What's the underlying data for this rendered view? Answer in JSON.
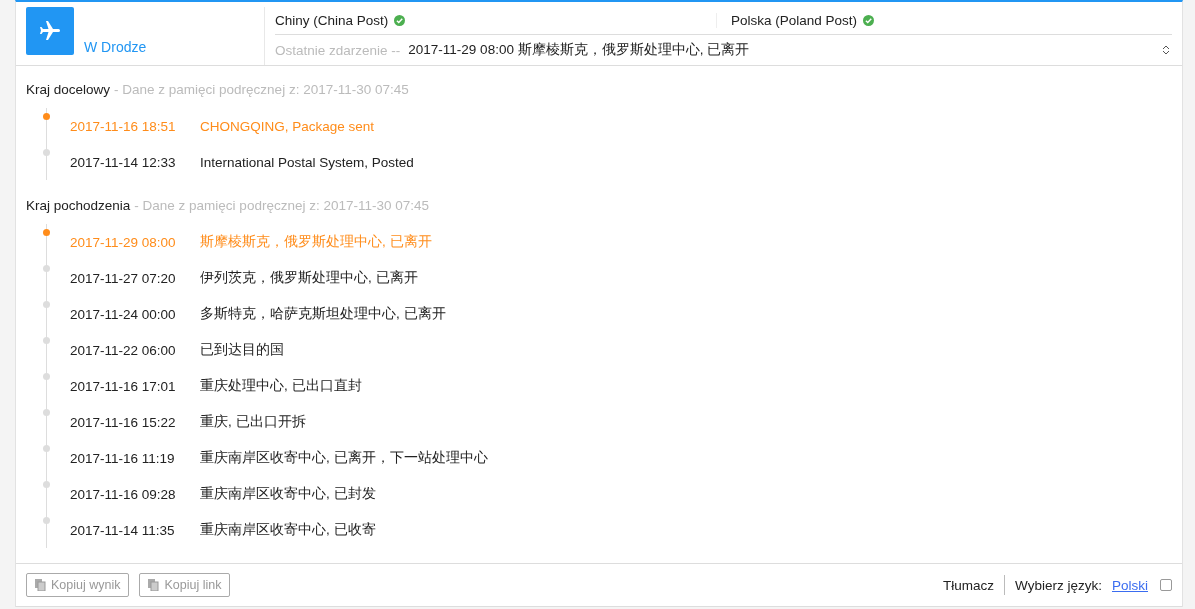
{
  "header": {
    "status": "W Drodze",
    "carriers": [
      {
        "name": "Chiny (China Post)",
        "verified": true
      },
      {
        "name": "Polska (Poland Post)",
        "verified": true
      }
    ],
    "last_event_label": "Ostatnie zdarzenie --",
    "last_event": "2017-11-29 08:00 斯摩棱斯克，俄罗斯处理中心, 已离开",
    "expanded": false
  },
  "sections": [
    {
      "title": "Kraj docelowy",
      "cache_note": "- Dane z pamięci podręcznej z: 2017-11-30 07:45",
      "events": [
        {
          "time": "2017-11-16 18:51",
          "text": "CHONGQING, Package sent",
          "latest": true
        },
        {
          "time": "2017-11-14 12:33",
          "text": "International Postal System, Posted",
          "latest": false
        }
      ]
    },
    {
      "title": "Kraj pochodzenia",
      "cache_note": "- Dane z pamięci podręcznej z: 2017-11-30 07:45",
      "events": [
        {
          "time": "2017-11-29 08:00",
          "text": "斯摩棱斯克，俄罗斯处理中心, 已离开",
          "latest": true
        },
        {
          "time": "2017-11-27 07:20",
          "text": "伊列茨克，俄罗斯处理中心, 已离开",
          "latest": false
        },
        {
          "time": "2017-11-24 00:00",
          "text": "多斯特克，哈萨克斯坦处理中心, 已离开",
          "latest": false
        },
        {
          "time": "2017-11-22 06:00",
          "text": "已到达目的国",
          "latest": false
        },
        {
          "time": "2017-11-16 17:01",
          "text": "重庆处理中心, 已出口直封",
          "latest": false
        },
        {
          "time": "2017-11-16 15:22",
          "text": "重庆, 已出口开拆",
          "latest": false
        },
        {
          "time": "2017-11-16 11:19",
          "text": "重庆南岸区收寄中心, 已离开，下一站处理中心",
          "latest": false
        },
        {
          "time": "2017-11-16 09:28",
          "text": "重庆南岸区收寄中心, 已封发",
          "latest": false
        },
        {
          "time": "2017-11-14 11:35",
          "text": "重庆南岸区收寄中心, 已收寄",
          "latest": false
        }
      ]
    }
  ],
  "footer": {
    "buttons": [
      "Kopiuj wynik",
      "Kopiuj link"
    ],
    "translator": "Tłumacz",
    "language_label": "Wybierz język:",
    "language": "Polski",
    "checked": false
  }
}
